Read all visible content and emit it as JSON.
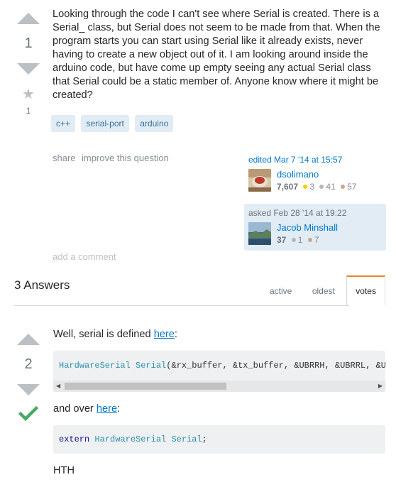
{
  "question": {
    "votes": "1",
    "favorites": "1",
    "body": "Looking through the code I can't see where Serial is created. There is a Serial_ class, but Serial does not seem to be made from that. When the program starts you can start using Serial like it already exists, never having to create a new object out of it. I am looking around inside the arduino code, but have come up empty seeing any actual Serial class that Serial could be a static member of. Anyone know where it might be created?",
    "tags": [
      "c++",
      "serial-port",
      "arduino"
    ],
    "menu": {
      "share": "share",
      "improve": "improve this question"
    },
    "edited": {
      "action": "edited Mar 7 '14 at 15:57",
      "name": "dsolimano",
      "rep": "7,607",
      "gold": "3",
      "silver": "41",
      "bronze": "57"
    },
    "asked": {
      "action": "asked Feb 28 '14 at 19:22",
      "name": "Jacob Minshall",
      "rep": "37",
      "silver": "1",
      "bronze": "7"
    },
    "add_comment": "add a comment"
  },
  "answers_header": {
    "count_label": "3 Answers",
    "tabs": [
      "active",
      "oldest",
      "votes"
    ],
    "active_tab": "votes"
  },
  "answer": {
    "votes": "2",
    "line1_prefix": "Well, serial is defined ",
    "line1_link": "here",
    "line1_suffix": ":",
    "code1": {
      "type": "HardwareSerial",
      "name": " Serial",
      "rest": "(&rx_buffer, &tx_buffer, &UBRRH, &UBRRL, &UC"
    },
    "line2_prefix": "and over ",
    "line2_link": "here",
    "line2_suffix": ":",
    "code2": {
      "kw": "extern",
      "type": " HardwareSerial",
      "name": " Serial",
      "rest": ";"
    },
    "closing": "HTH"
  },
  "colors": {
    "accent_tab": "#f48024",
    "accepted": "#48a868",
    "link": "#0077cc",
    "tag_bg": "#e1ecf4"
  }
}
